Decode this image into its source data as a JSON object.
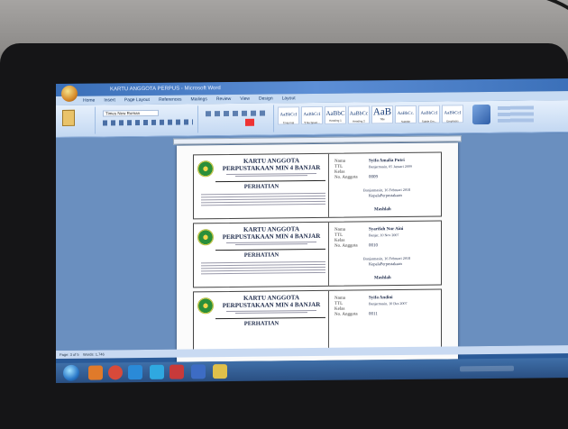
{
  "window": {
    "title": "KARTU ANGGOTA PERPUS - Microsoft Word",
    "tabs": [
      "Home",
      "Insert",
      "Page Layout",
      "References",
      "Mailings",
      "Review",
      "View",
      "Design",
      "Layout"
    ]
  },
  "ribbon": {
    "font_name": "Times New Roman",
    "styles": [
      {
        "preview": "AaBbCcI",
        "name": "¶ Normal"
      },
      {
        "preview": "AaBbCcI",
        "name": "¶ No Spaci..."
      },
      {
        "preview": "AaBbC",
        "name": "Heading 1"
      },
      {
        "preview": "AaBbCc",
        "name": "Heading 2"
      },
      {
        "preview": "AaB",
        "name": "Title"
      },
      {
        "preview": "AaBbCc.",
        "name": "Subtitle"
      },
      {
        "preview": "AaBbCcI",
        "name": "Subtle Em..."
      },
      {
        "preview": "AaBbCcI",
        "name": "Emphasis"
      }
    ]
  },
  "cards": [
    {
      "title1": "KARTU ANGGOTA",
      "title2": "PERPUSTAKAAN MIN 4 BANJAR",
      "perhatian": "PERHATIAN",
      "labels": [
        "Nama",
        "TTL",
        "Kelas",
        "No. Anggota"
      ],
      "values": [
        "Syifa Amalia Putri",
        "Banjarmasin, 05 Januari 2009",
        "",
        "0009"
      ],
      "footer_place": "Banjarmasin, 16 Februari 2018",
      "footer_role": "KepalaPerpustakaan",
      "footer_name": "Mashlah"
    },
    {
      "title1": "KARTU ANGGOTA",
      "title2": "PERPUSTAKAAN MIN 4 BANJAR",
      "perhatian": "PERHATIAN",
      "labels": [
        "Nama",
        "TTL",
        "Kelas",
        "No. Anggota"
      ],
      "values": [
        "Syarifah Nur Aini",
        "Banjar, 10 Nov 2007",
        "",
        "0010"
      ],
      "footer_place": "Banjarmasin, 16 Februari 2018",
      "footer_role": "KepalaPerpustakaan",
      "footer_name": "Mashlah"
    },
    {
      "title1": "KARTU ANGGOTA",
      "title2": "PERPUSTAKAAN MIN 4 BANJAR",
      "perhatian": "PERHATIAN",
      "labels": [
        "Nama",
        "TTL",
        "Kelas",
        "No. Anggota"
      ],
      "values": [
        "Syifa Andini",
        "Banjarmasin, 10 Des 2007",
        "",
        "0011"
      ]
    }
  ],
  "status": {
    "page": "Page: 3 of 5",
    "words": "Words: 1,746"
  }
}
